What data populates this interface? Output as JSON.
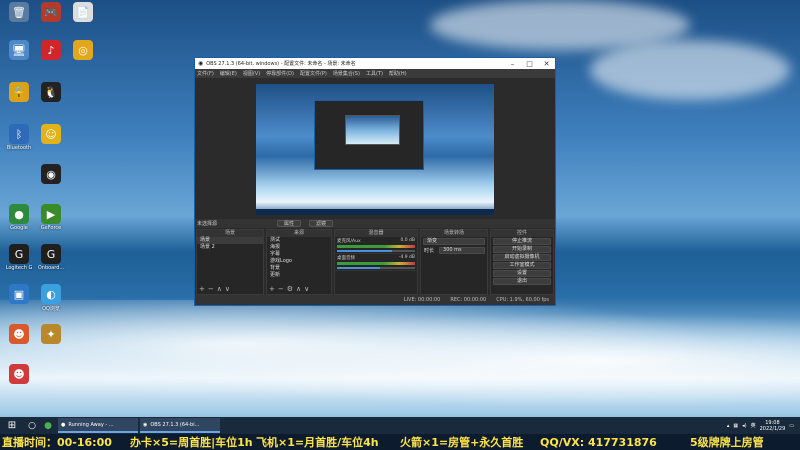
{
  "desktop": {
    "icons": [
      {
        "name": "recycle-bin",
        "label": "",
        "glyph": "🗑",
        "color": "#5a7aa0"
      },
      {
        "name": "game-app",
        "label": "",
        "glyph": "🎮",
        "color": "#b33b2b"
      },
      {
        "name": "file",
        "label": "",
        "glyph": "📄",
        "color": "#dddddd"
      },
      {
        "name": "computer",
        "label": "",
        "glyph": "🖥",
        "color": "#4d88c8"
      },
      {
        "name": "netease-music",
        "label": "",
        "glyph": "♪",
        "color": "#d0262b"
      },
      {
        "name": "app-yellow",
        "label": "",
        "glyph": "◎",
        "color": "#e0a81a"
      },
      {
        "name": "lock-app",
        "label": "",
        "glyph": "🔒",
        "color": "#d8a21c"
      },
      {
        "name": "qq",
        "label": "",
        "glyph": "🐧",
        "color": "#222222"
      },
      {
        "name": "bluetooth",
        "label": "Bluetooth",
        "glyph": "ᛒ",
        "color": "#2f6ab8"
      },
      {
        "name": "face-app",
        "label": "",
        "glyph": "☺",
        "color": "#e2b21a"
      },
      {
        "name": "obs",
        "label": "",
        "glyph": "◉",
        "color": "#222222"
      },
      {
        "name": "chrome",
        "label": "Google",
        "glyph": "●",
        "color": "#2e8b3e"
      },
      {
        "name": "nvidia",
        "label": "GeForce",
        "glyph": "▶",
        "color": "#3a8b2a"
      },
      {
        "name": "logitech",
        "label": "Logitech G",
        "glyph": "G",
        "color": "#1f1f1f"
      },
      {
        "name": "onboard",
        "label": "Onboard...",
        "glyph": "G",
        "color": "#1f1f1f"
      },
      {
        "name": "app-blue",
        "label": "",
        "glyph": "▣",
        "color": "#2f78c8"
      },
      {
        "name": "qq-browser",
        "label": "QQ浏览",
        "glyph": "◐",
        "color": "#3aa0e0"
      },
      {
        "name": "person-app",
        "label": "",
        "glyph": "☻",
        "color": "#d85a2a"
      },
      {
        "name": "game-app-2",
        "label": "",
        "glyph": "✦",
        "color": "#b8892a"
      },
      {
        "name": "char-app",
        "label": "",
        "glyph": "☻",
        "color": "#d03a3a"
      }
    ]
  },
  "obs": {
    "title": "OBS 27.1.3 (64-bit, windows) - 配置文件: 未命名 - 场景: 未命名",
    "menu": [
      "文件(F)",
      "编辑(E)",
      "视图(V)",
      "停靠部件(D)",
      "配置文件(P)",
      "场景集合(S)",
      "工具(T)",
      "帮助(H)"
    ],
    "source_bar": {
      "label": "未选择源",
      "props": "属性",
      "filters": "滤镜"
    },
    "scenes": {
      "header": "场景",
      "items": [
        "场景",
        "场景 2"
      ]
    },
    "sources": {
      "header": "来源",
      "items": [
        "测试",
        "海报",
        "字幕",
        "游戏Logo",
        "背景",
        "更新"
      ]
    },
    "mixer": {
      "header": "混音器",
      "channels": [
        {
          "name": "麦克风/Aux",
          "db": "0.0 dB"
        },
        {
          "name": "桌面音频",
          "db": "-4.9 dB"
        }
      ]
    },
    "transitions": {
      "header": "场景转场",
      "type": "渐变",
      "duration_label": "时长",
      "duration": "300 ms"
    },
    "controls": {
      "header": "控件",
      "buttons": [
        "停止推流",
        "开始录制",
        "启动虚拟摄像机",
        "工作室模式",
        "设置",
        "退出"
      ]
    },
    "status": {
      "live": "LIVE: 00:00:00",
      "rec": "REC: 00:00:00",
      "cpu": "CPU: 1.9%, 60.00 fps"
    }
  },
  "taskbar": {
    "apps": [
      {
        "label": "Running Away - ..."
      },
      {
        "label": "OBS 27.1.3 (64-bi..."
      }
    ],
    "time": "19:08",
    "date": "2022/1/29",
    "lang": "英"
  },
  "banner": {
    "items": [
      "直播时间：00-16:00",
      "办卡×5=周首胜|车位1h",
      "飞机×1=月首胜/车位4h",
      "火箭×1=房管+永久首胜",
      "QQ/VX: 417731876",
      "5级牌牌上房管"
    ]
  }
}
